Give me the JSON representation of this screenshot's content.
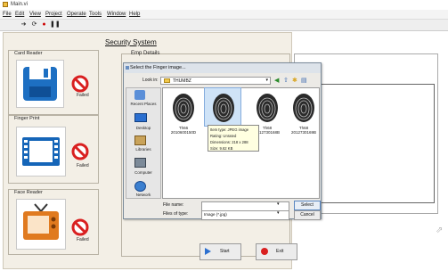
{
  "window": {
    "title": "Main.vi"
  },
  "menu": [
    "File",
    "Edit",
    "View",
    "Project",
    "Operate",
    "Tools",
    "Window",
    "Help"
  ],
  "main": {
    "title": "Security System",
    "groups": {
      "card_reader": {
        "label": "Card Reader",
        "status": "Failed"
      },
      "finger_print": {
        "label": "Finger Print",
        "status": "Failed"
      },
      "face_reader": {
        "label": "Face Reader",
        "status": "Failed"
      }
    },
    "emp_details": {
      "label": "Emp Details"
    },
    "buttons": {
      "start": "Start",
      "exit": "Exit"
    }
  },
  "dialog": {
    "title": "Select the Finger image...",
    "look_in_label": "Look in:",
    "look_in_value": "THUMBZ",
    "places": [
      "Recent Places",
      "Desktop",
      "Libraries",
      "Computer",
      "Network"
    ],
    "files": [
      {
        "name": "Th66 2010600150D"
      },
      {
        "name": ""
      },
      {
        "name": "Th68 2012730168B"
      },
      {
        "name": "Th68 2012730169B"
      }
    ],
    "tooltip": [
      "Item type: JPEG image",
      "Rating: Unrated",
      "Dimensions: 218 x 288",
      "Size: 9.62 KB"
    ],
    "file_name_label": "File name:",
    "file_name_value": "",
    "files_of_type_label": "Files of type:",
    "files_of_type_value": "Image (*.jpg)",
    "select_button": "Select",
    "cancel_button": "Cancel"
  },
  "colors": {
    "floppy": "#1d6fc2",
    "film": "#1565b8",
    "tv": "#e07a1f",
    "stop": "#d92020"
  }
}
